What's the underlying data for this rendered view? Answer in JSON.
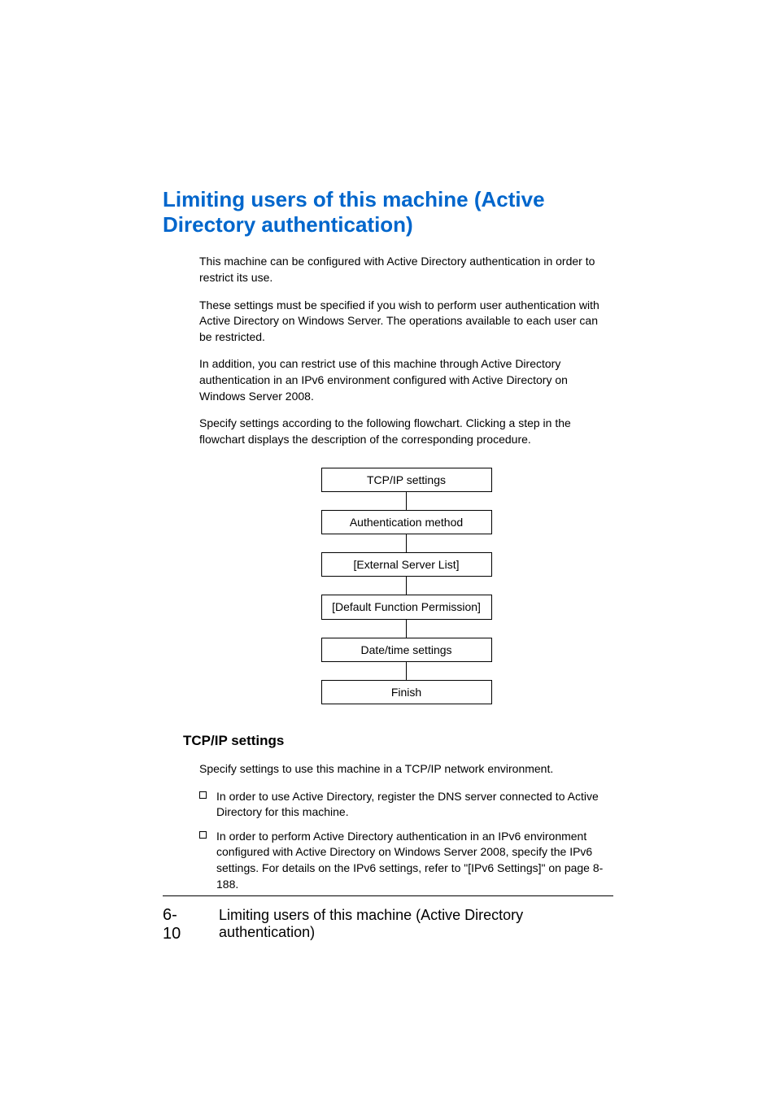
{
  "heading": "Limiting users of this machine (Active Directory authentication)",
  "paragraphs": {
    "p1": "This machine can be configured with Active Directory authentication in order to restrict its use.",
    "p2": "These settings must be specified if you wish to perform user authentication with Active Directory on Windows Server. The operations available to each user can be restricted.",
    "p3": "In addition, you can restrict use of this machine through Active Directory authentication in an IPv6 environment configured with Active Directory on Windows Server 2008.",
    "p4": "Specify settings according to the following flowchart. Clicking a step in the flowchart displays the description of the corresponding procedure."
  },
  "flowchart": {
    "step1": "TCP/IP settings",
    "step2": "Authentication method",
    "step3": "[External Server List]",
    "step4": "[Default Function Permission]",
    "step5": "Date/time settings",
    "step6": "Finish"
  },
  "subheading": "TCP/IP settings",
  "subtext": "Specify settings to use this machine in a TCP/IP network environment.",
  "bullets": {
    "b1": "In order to use Active Directory, register the DNS server connected to Active Directory for this machine.",
    "b2": "In order to perform Active Directory authentication in an IPv6 environment configured with Active Directory on Windows Server 2008, specify the IPv6 settings. For details on the IPv6 settings, refer to \"[IPv6 Settings]\" on page 8-188."
  },
  "footer": {
    "page": "6-10",
    "title": "Limiting users of this machine (Active Directory authentication)"
  }
}
